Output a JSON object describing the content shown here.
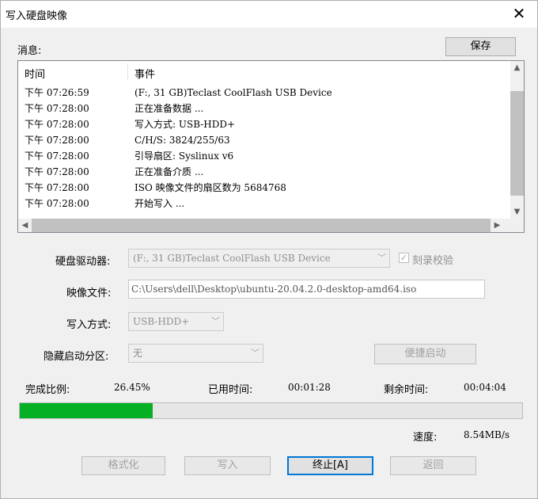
{
  "window": {
    "title": "写入硬盘映像"
  },
  "messages": {
    "label": "消息:",
    "save_button": "保存",
    "columns": [
      "时间",
      "事件"
    ],
    "rows": [
      {
        "time": "下午 07:26:59",
        "event": "(F:, 31 GB)Teclast CoolFlash USB Device"
      },
      {
        "time": "下午 07:28:00",
        "event": "正在准备数据 ..."
      },
      {
        "time": "下午 07:28:00",
        "event": "写入方式: USB-HDD+"
      },
      {
        "time": "下午 07:28:00",
        "event": "C/H/S: 3824/255/63"
      },
      {
        "time": "下午 07:28:00",
        "event": "引导扇区: Syslinux v6"
      },
      {
        "time": "下午 07:28:00",
        "event": "正在准备介质 ..."
      },
      {
        "time": "下午 07:28:00",
        "event": "ISO 映像文件的扇区数为 5684768"
      },
      {
        "time": "下午 07:28:00",
        "event": "开始写入 ..."
      }
    ]
  },
  "form": {
    "drive_label": "硬盘驱动器:",
    "drive_value": "(F:, 31 GB)Teclast CoolFlash USB Device",
    "verify_label": "刻录校验",
    "verify_checked": true,
    "image_label": "映像文件:",
    "image_value": "C:\\Users\\dell\\Desktop\\ubuntu-20.04.2.0-desktop-amd64.iso",
    "method_label": "写入方式:",
    "method_value": "USB-HDD+",
    "hidden_label": "隐藏启动分区:",
    "hidden_value": "无",
    "quickboot_button": "便捷启动"
  },
  "status": {
    "percent_label": "完成比例:",
    "percent_value": "26.45%",
    "elapsed_label": "已用时间:",
    "elapsed_value": "00:01:28",
    "remaining_label": "剩余时间:",
    "remaining_value": "00:04:04",
    "progress_fraction": 0.2645,
    "speed_label": "速度:",
    "speed_value": "8.54MB/s",
    "progress_color": "#06b025"
  },
  "buttons": {
    "format": "格式化",
    "write": "写入",
    "abort": "终止[A]",
    "back": "返回"
  }
}
